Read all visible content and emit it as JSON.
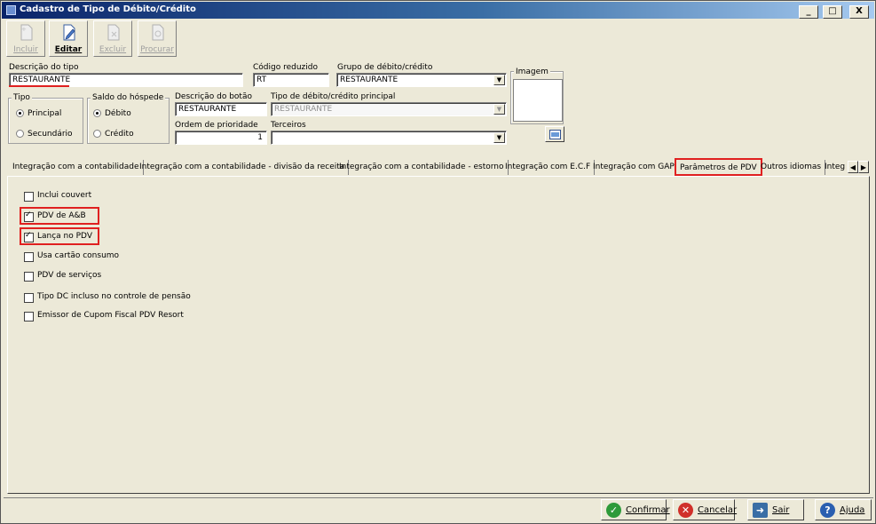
{
  "window": {
    "title": "Cadastro de Tipo de Débito/Crédito",
    "minimize": "_",
    "maximize": "□",
    "close": "X"
  },
  "toolbar": {
    "buttons": [
      {
        "label": "Incluir",
        "enabled": false,
        "icon": "new-document-icon"
      },
      {
        "label": "Editar",
        "enabled": true,
        "icon": "edit-pencil-icon"
      },
      {
        "label": "Excluir",
        "enabled": false,
        "icon": "delete-document-icon"
      },
      {
        "label": "Procurar",
        "enabled": false,
        "icon": "search-document-icon"
      }
    ]
  },
  "form": {
    "descricao_tipo": {
      "label": "Descrição do tipo",
      "value": "RESTAURANTE"
    },
    "codigo_reduzido": {
      "label": "Código reduzido",
      "value": "RT"
    },
    "grupo": {
      "label": "Grupo de débito/crédito",
      "value": "RESTAURANTE"
    },
    "imagem": {
      "label": "Imagem"
    },
    "tipo": {
      "label": "Tipo",
      "options": [
        "Principal",
        "Secundário"
      ],
      "selected": "Principal"
    },
    "saldo": {
      "label": "Saldo do hóspede",
      "options": [
        "Débito",
        "Crédito"
      ],
      "selected": "Débito"
    },
    "descricao_botao": {
      "label": "Descrição do botão",
      "value": "RESTAURANTE"
    },
    "tipo_principal": {
      "label": "Tipo de débito/crédito principal",
      "value": "RESTAURANTE"
    },
    "ordem": {
      "label": "Ordem de prioridade",
      "value": "1"
    },
    "terceiros": {
      "label": "Terceiros",
      "value": ""
    }
  },
  "tabs": [
    {
      "label": "Integração com a contabilidade",
      "active": false
    },
    {
      "label": "Integração com a contabilidade - divisão da receita",
      "active": false
    },
    {
      "label": "Integração com a contabilidade - estorno",
      "active": false
    },
    {
      "label": "Integração com E.C.F",
      "active": false
    },
    {
      "label": "Integração com GAP",
      "active": false
    },
    {
      "label": "Parâmetros de PDV",
      "active": true
    },
    {
      "label": "Outros idiomas",
      "active": false
    },
    {
      "label": "Integ",
      "active": false
    }
  ],
  "checkboxes": [
    {
      "label": "Inclui couvert",
      "checked": false,
      "highlight": false
    },
    {
      "label": "PDV de A&B",
      "checked": true,
      "highlight": true
    },
    {
      "label": "Lança no PDV",
      "checked": true,
      "highlight": true
    },
    {
      "label": "Usa cartão consumo",
      "checked": false,
      "highlight": false
    },
    {
      "label": "PDV de serviços",
      "checked": false,
      "highlight": false
    },
    {
      "label": "Tipo DC incluso no controle de pensão",
      "checked": false,
      "highlight": false
    },
    {
      "label": "Emissor de Cupom Fiscal PDV Resort",
      "checked": false,
      "highlight": false
    }
  ],
  "bottom_buttons": [
    {
      "label": "Confirmar",
      "icon": "check-circle-icon",
      "color": "#2e9a3a"
    },
    {
      "label": "Cancelar",
      "icon": "cancel-circle-icon",
      "color": "#d0302a"
    },
    {
      "label": "Sair",
      "icon": "exit-door-icon",
      "color": "#3a6ea5"
    },
    {
      "label": "Ajuda",
      "icon": "help-circle-icon",
      "color": "#2a5fb0"
    }
  ],
  "colors": {
    "highlight": "#e02020",
    "title_bar": "#0a246a"
  }
}
